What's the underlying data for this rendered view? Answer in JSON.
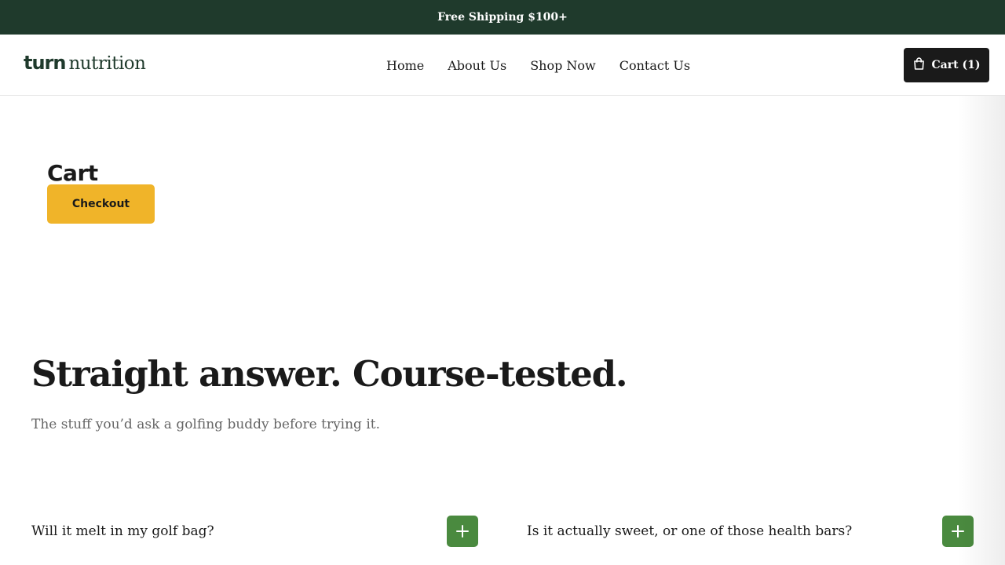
{
  "announcement": {
    "text": "Free Shipping $100+"
  },
  "header": {
    "logo": {
      "turn": "turn",
      "nutrition": "nutrition"
    },
    "nav": [
      {
        "label": "Home"
      },
      {
        "label": "About Us"
      },
      {
        "label": "Shop Now"
      },
      {
        "label": "Contact Us"
      }
    ],
    "cart_button": {
      "label": "Cart (1)",
      "icon": "shopping-bag-icon"
    }
  },
  "cart": {
    "heading": "Cart",
    "checkout_label": "Checkout"
  },
  "faq": {
    "title": "Straight answer. Course-tested.",
    "subtitle": "The stuff you’d ask a golfing buddy before trying it.",
    "items": [
      {
        "question": "Will it melt in my golf bag?",
        "icon": "plus-icon"
      },
      {
        "question": "Is it actually sweet, or one of those health bars?",
        "icon": "plus-icon"
      }
    ]
  },
  "colors": {
    "announcement_bg": "#1f3a2c",
    "checkout_bg": "#f0b429",
    "accordion_button_bg": "#4a8a3f",
    "cart_button_bg": "#1a1a1a"
  }
}
